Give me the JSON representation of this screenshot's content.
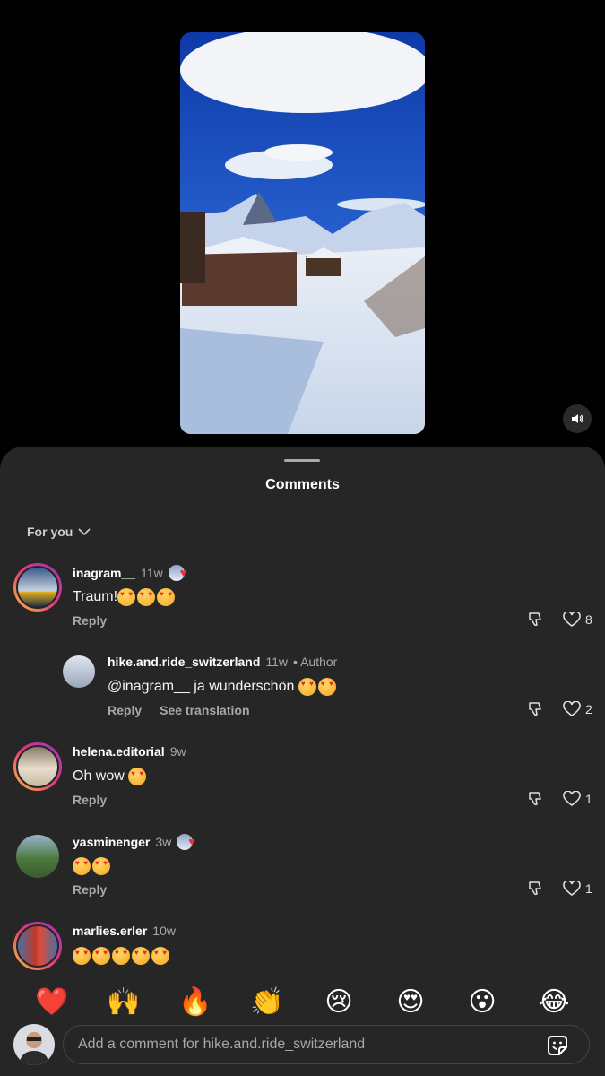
{
  "video": {
    "sound_icon": "speaker-icon"
  },
  "sheet": {
    "title": "Comments",
    "sort_label": "For you"
  },
  "comments": [
    {
      "username": "inagram__",
      "time": "11w",
      "text": "Traum!",
      "emoji_count": 3,
      "reply_label": "Reply",
      "likes": "8",
      "author_liked": true
    },
    {
      "username": "hike.and.ride_switzerland",
      "time": "11w",
      "author_label": "• Author",
      "text": "@inagram__ ja wunderschön",
      "emoji_count": 2,
      "reply_label": "Reply",
      "translate_label": "See translation",
      "likes": "2"
    },
    {
      "username": "helena.editorial",
      "time": "9w",
      "text": "Oh wow",
      "emoji_count": 1,
      "reply_label": "Reply",
      "likes": "1"
    },
    {
      "username": "yasminenger",
      "time": "3w",
      "text": "",
      "emoji_count": 2,
      "reply_label": "Reply",
      "likes": "1",
      "author_liked": true
    },
    {
      "username": "marlies.erler",
      "time": "10w",
      "text": "",
      "emoji_count": 5
    }
  ],
  "quick_reactions": [
    "❤️",
    "🙌",
    "🔥",
    "👏",
    "😢",
    "😍",
    "😮",
    "😂"
  ],
  "composer": {
    "placeholder": "Add a comment for hike.and.ride_switzerland"
  },
  "colors": {
    "sheet_bg": "#262626",
    "muted_text": "#a8a8a8",
    "heart_red": "#ed2f3c"
  }
}
